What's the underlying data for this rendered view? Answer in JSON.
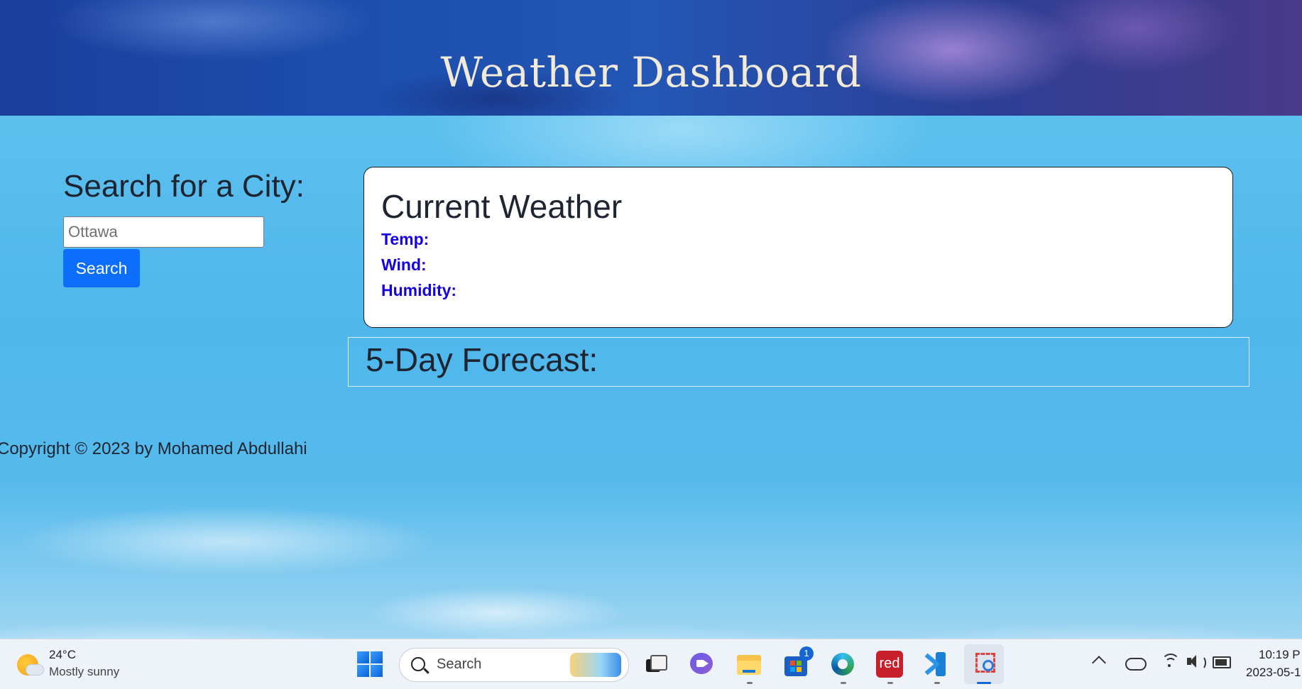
{
  "header": {
    "title": "Weather Dashboard"
  },
  "search": {
    "heading": "Search for a City:",
    "placeholder": "Ottawa",
    "value": "",
    "button_label": "Search"
  },
  "current_weather": {
    "title": "Current Weather",
    "temp_label": "Temp:",
    "wind_label": "Wind:",
    "humidity_label": "Humidity:"
  },
  "forecast": {
    "title": "5-Day Forecast:"
  },
  "footer": {
    "copyright": "Copyright © 2023 by Mohamed Abdullahi"
  },
  "colors": {
    "accent": "#0d6efd",
    "metric_label": "#1400e6",
    "heading_text": "#1e2430",
    "header_title": "#f2ead8"
  },
  "taskbar": {
    "weather_temp": "24°C",
    "weather_condition": "Mostly sunny",
    "search_label": "Search",
    "store_badge": "1",
    "red_app_label": "red",
    "time": "10:19 P",
    "date": "2023-05-1",
    "icons": [
      "start-icon",
      "search-icon",
      "task-view-icon",
      "teams-chat-icon",
      "file-explorer-icon",
      "microsoft-store-icon",
      "edge-icon",
      "red-app-icon",
      "vscode-icon",
      "snipping-tool-icon",
      "chevron-up-icon",
      "onedrive-icon",
      "wifi-icon",
      "volume-icon",
      "battery-icon"
    ]
  }
}
